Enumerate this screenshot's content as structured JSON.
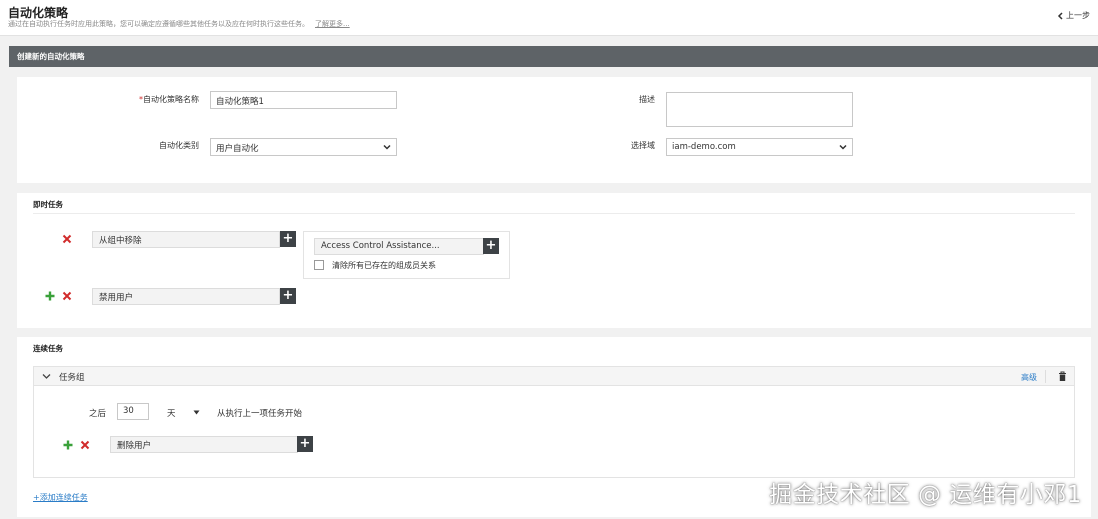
{
  "header": {
    "title": "自动化策略",
    "subtitle": "通过在自动执行任务时应用此策略，您可以确定应遵循哪些其他任务以及应在何时执行这些任务。",
    "learn_more": "了解更多...",
    "back_label": "上一步"
  },
  "section_bar": {
    "title": "创建新的自动化策略"
  },
  "form": {
    "name_label": "自动化策略名称",
    "name_required_mark": "*",
    "name_value": "自动化策略1",
    "category_label": "自动化类别",
    "category_value": "用户自动化",
    "description_label": "描述",
    "description_value": "",
    "domain_label": "选择域",
    "domain_value": "iam-demo.com"
  },
  "immediate": {
    "title": "即时任务",
    "tasks": [
      {
        "label": "从组中移除"
      },
      {
        "label": "禁用用户"
      }
    ],
    "sub": {
      "group_value": "Access Control Assistance...",
      "checkbox_label": "清除所有已存在的组成员关系",
      "checked": false
    }
  },
  "continuous": {
    "title": "连续任务",
    "group_title": "任务组",
    "advanced_label": "高级",
    "after_label": "之后",
    "days_value": "30",
    "unit_value": "天",
    "from_label": "从执行上一项任务开始",
    "task_label": "删除用户",
    "add_link": "+添加连续任务"
  },
  "watermark": "掘金技术社区 @ 运维有小邓1",
  "colors": {
    "section_bar_bg": "#5e6367",
    "delete_red": "#d12b2b",
    "add_green": "#3aa13a",
    "plus_button_bg": "#3d4246",
    "link_blue": "#2a7cc7"
  }
}
